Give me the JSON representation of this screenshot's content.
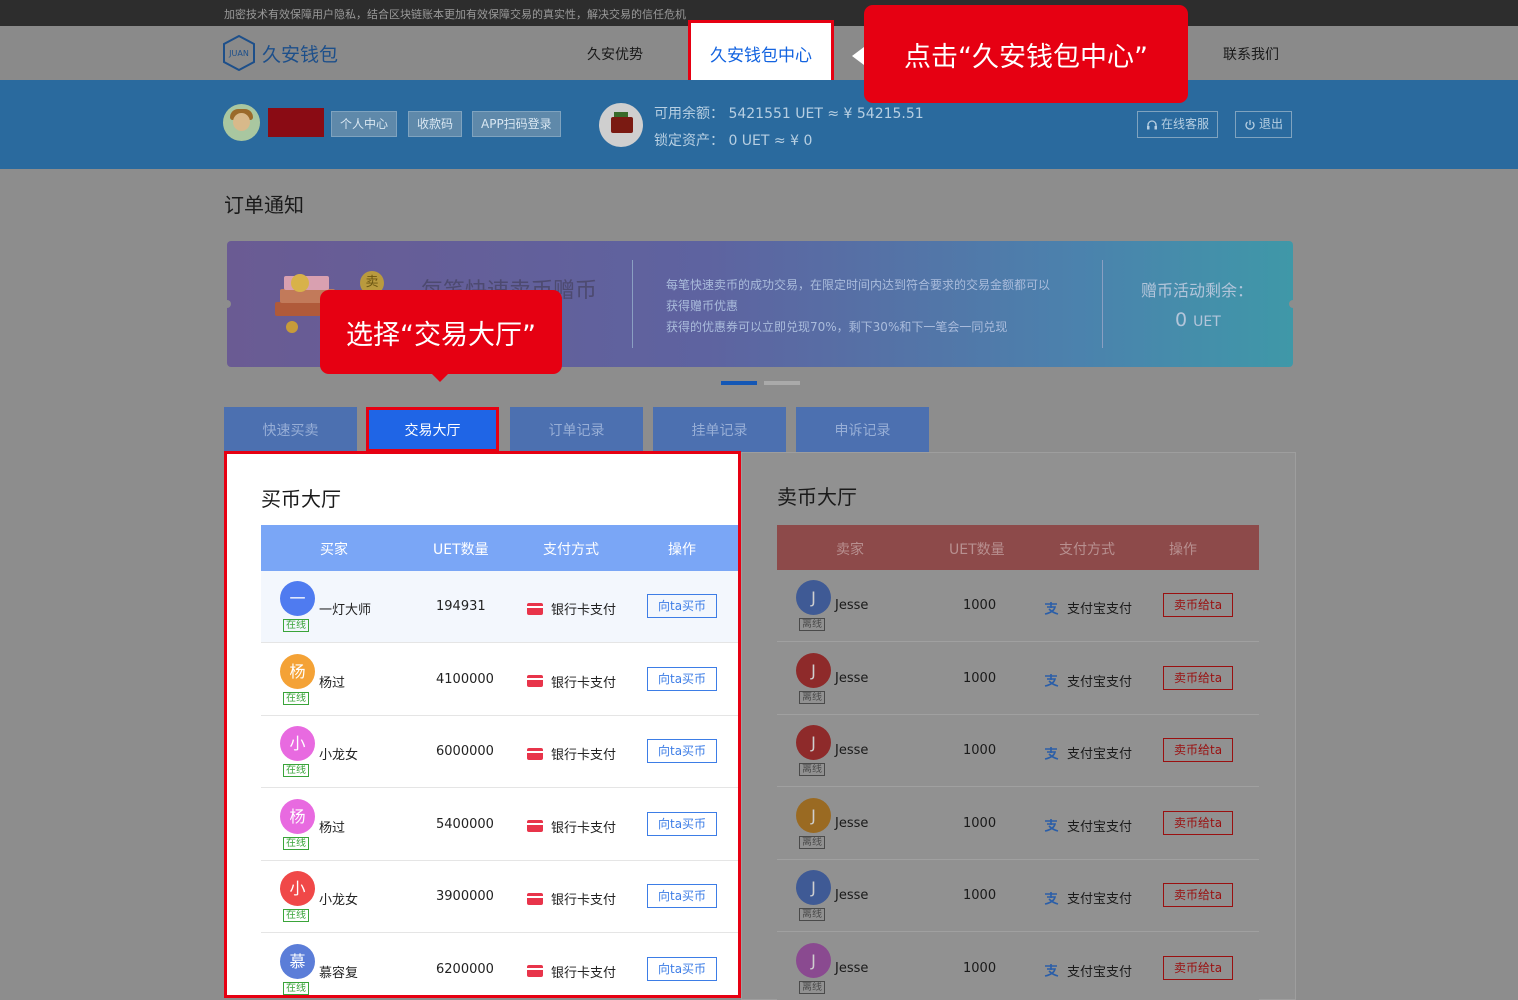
{
  "top_notice": "加密技术有效保障用户隐私，结合区块链账本更加有效保障交易的真实性，解决交易的信任危机",
  "logo": {
    "mark": "JUAN",
    "text": "久安钱包"
  },
  "nav": {
    "items": [
      "久安优势",
      "久安钱包中心",
      "联系我们"
    ]
  },
  "user": {
    "buttons": [
      "个人中心",
      "收款码",
      "APP扫码登录"
    ],
    "available": "可用余额：  5421551 UET ≈ ¥ 54215.51",
    "locked": "锁定资产：  0 UET ≈ ¥ 0",
    "service_label": "在线客服",
    "logout_label": "退出"
  },
  "section_title": "订单通知",
  "promo": {
    "badge": "卖",
    "title": "每笔快速卖币赠币",
    "desc": [
      "每笔快速卖币的成功交易，在限定时间内达到符合要求的交易金额都可以",
      "获得赠币优惠",
      "获得的优惠券可以立即兑现70%，剩下30%和下一笔会一同兑现"
    ],
    "remain_label": "赠币活动剩余：",
    "remain_value": "0",
    "remain_unit": "UET"
  },
  "callouts": {
    "c1": "点击“久安钱包中心”",
    "c2": "选择“交易大厅”"
  },
  "tabs": [
    "快速买卖",
    "交易大厅",
    "订单记录",
    "挂单记录",
    "申诉记录"
  ],
  "buy_hall": {
    "title": "买币大厅",
    "headers": [
      "买家",
      "UET数量",
      "支付方式",
      "操作"
    ],
    "rows": [
      {
        "initial": "一",
        "name": "一灯大师",
        "qty": "194931",
        "pay": "银行卡支付",
        "status": "在线",
        "action": "向ta买币",
        "color": "#4f7bf0"
      },
      {
        "initial": "杨",
        "name": "杨过",
        "qty": "4100000",
        "pay": "银行卡支付",
        "status": "在线",
        "action": "向ta买币",
        "color": "#f4a236"
      },
      {
        "initial": "小",
        "name": "小龙女",
        "qty": "6000000",
        "pay": "银行卡支付",
        "status": "在线",
        "action": "向ta买币",
        "color": "#e86ae0"
      },
      {
        "initial": "杨",
        "name": "杨过",
        "qty": "5400000",
        "pay": "银行卡支付",
        "status": "在线",
        "action": "向ta买币",
        "color": "#e86ae0"
      },
      {
        "initial": "小",
        "name": "小龙女",
        "qty": "3900000",
        "pay": "银行卡支付",
        "status": "在线",
        "action": "向ta买币",
        "color": "#f04848"
      },
      {
        "initial": "慕",
        "name": "慕容复",
        "qty": "6200000",
        "pay": "银行卡支付",
        "status": "在线",
        "action": "向ta买币",
        "color": "#5b7dd8"
      }
    ]
  },
  "sell_hall": {
    "title": "卖币大厅",
    "headers": [
      "卖家",
      "UET数量",
      "支付方式",
      "操作"
    ],
    "rows": [
      {
        "initial": "J",
        "name": "Jesse",
        "qty": "1000",
        "pay": "支付宝支付",
        "status": "离线",
        "action": "卖币给ta",
        "color": "#3f5a95"
      },
      {
        "initial": "J",
        "name": "Jesse",
        "qty": "1000",
        "pay": "支付宝支付",
        "status": "离线",
        "action": "卖币给ta",
        "color": "#8e2a2a"
      },
      {
        "initial": "J",
        "name": "Jesse",
        "qty": "1000",
        "pay": "支付宝支付",
        "status": "离线",
        "action": "卖币给ta",
        "color": "#8e2a2a"
      },
      {
        "initial": "J",
        "name": "Jesse",
        "qty": "1000",
        "pay": "支付宝支付",
        "status": "离线",
        "action": "卖币给ta",
        "color": "#9a6a22"
      },
      {
        "initial": "J",
        "name": "Jesse",
        "qty": "1000",
        "pay": "支付宝支付",
        "status": "离线",
        "action": "卖币给ta",
        "color": "#3f5a95"
      },
      {
        "initial": "J",
        "name": "Jesse",
        "qty": "1000",
        "pay": "支付宝支付",
        "status": "离线",
        "action": "卖币给ta",
        "color": "#8a4a90"
      }
    ]
  }
}
